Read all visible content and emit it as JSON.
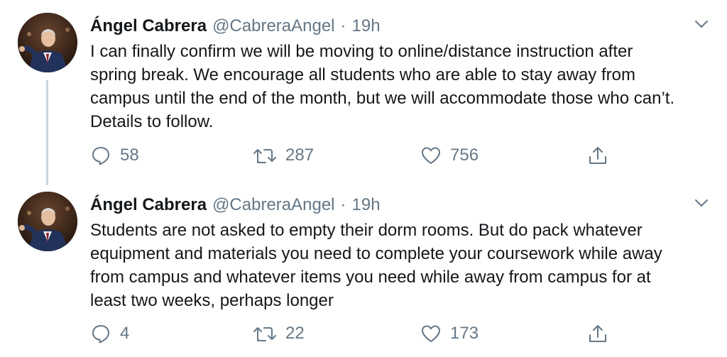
{
  "tweets": [
    {
      "author": {
        "name": "Ángel Cabrera",
        "handle": "@CabreraAngel"
      },
      "separator": "·",
      "time": "19h",
      "text_lines": [
        "I can finally confirm we will be moving to online/distance instruction after",
        "spring break. We encourage all students who are able to stay away from",
        "campus until the end of the month, but we will accommodate those who can’t.",
        "Details to follow."
      ],
      "stats": {
        "replies": "58",
        "retweets": "287",
        "likes": "756"
      }
    },
    {
      "author": {
        "name": "Ángel Cabrera",
        "handle": "@CabreraAngel"
      },
      "separator": "·",
      "time": "19h",
      "text_lines": [
        "Students are not asked to empty their dorm rooms. But do pack whatever",
        "equipment and materials you need to complete your coursework while away",
        "from campus and whatever items you need while away from campus for at",
        "least two weeks, perhaps longer"
      ],
      "stats": {
        "replies": "4",
        "retweets": "22",
        "likes": "173"
      }
    }
  ],
  "icons": {
    "reply": "reply-icon",
    "retweet": "retweet-icon",
    "like": "heart-icon",
    "share": "share-icon",
    "more": "chevron-down-icon"
  },
  "colors": {
    "text": "#14171a",
    "secondary": "#657786",
    "thread_line": "#ccd6dd"
  }
}
